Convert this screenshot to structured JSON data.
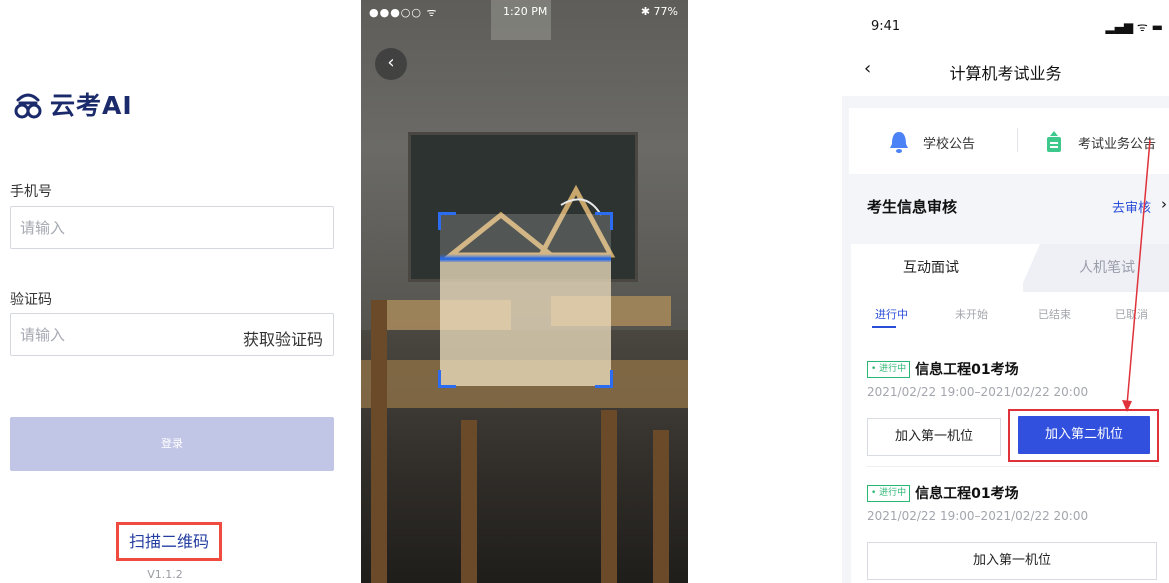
{
  "login": {
    "brand_name": "云考AI",
    "phone_label": "手机号",
    "phone_placeholder": "请输入",
    "code_label": "验证码",
    "code_placeholder": "请输入",
    "get_code_label": "获取验证码",
    "login_button_label": "登录",
    "scan_label": "扫描二维码",
    "version": "V1.1.2",
    "accent_color": "#243da1",
    "highlight_color": "#ef4c3f"
  },
  "scanner": {
    "status_left": "●●●○○ ᯤ",
    "status_time": "1:20 PM",
    "status_right": "✱ 77%",
    "back_icon": "chevron-left-icon"
  },
  "exam": {
    "status_time": "9:41",
    "status_icons": "▂▄▆ ᯤ ▬",
    "nav_title": "计算机考试业务",
    "notices": [
      {
        "label": "学校公告",
        "icon": "bell-icon"
      },
      {
        "label": "考试业务公告",
        "icon": "notice-icon"
      }
    ],
    "audit": {
      "label": "考生信息审核",
      "action": "去审核"
    },
    "tabs": [
      "互动面试",
      "人机笔试"
    ],
    "subtabs": [
      "进行中",
      "未开始",
      "已结束",
      "已取消"
    ],
    "items": [
      {
        "badge": "• 进行中",
        "name": "信息工程01考场",
        "time": "2021/02/22 19:00–2021/02/22 20:00",
        "first_button": "加入第一机位",
        "second_button": "加入第二机位"
      },
      {
        "badge": "• 进行中",
        "name": "信息工程01考场",
        "time": "2021/02/22 19:00–2021/02/22 20:00",
        "first_button": "加入第一机位"
      }
    ],
    "primary_color": "#3150de",
    "annotation_color": "#e0323a"
  }
}
